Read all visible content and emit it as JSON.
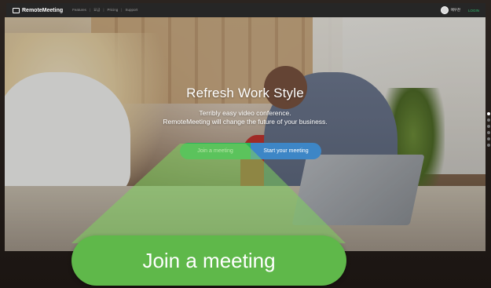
{
  "nav": {
    "logo_text": "RemoteMeeting",
    "links": [
      "Features",
      "|",
      "요금",
      "|",
      "Pricing",
      "|",
      "Support"
    ],
    "username": "에우찬",
    "login_label": "LOGIN"
  },
  "hero": {
    "title": "Refresh Work Style",
    "subtitle_line1": "Terribly easy video conference.",
    "subtitle_line2": "RemoteMeeting will change the future of your business."
  },
  "cta": {
    "join_label": "Join a meeting",
    "start_label": "Start your meeting"
  },
  "callout": {
    "label": "Join a meeting",
    "color": "#5fb84a"
  },
  "colors": {
    "join_green": "#2fb25a",
    "start_blue": "#3d86c6",
    "nav_bg": "#262626"
  }
}
